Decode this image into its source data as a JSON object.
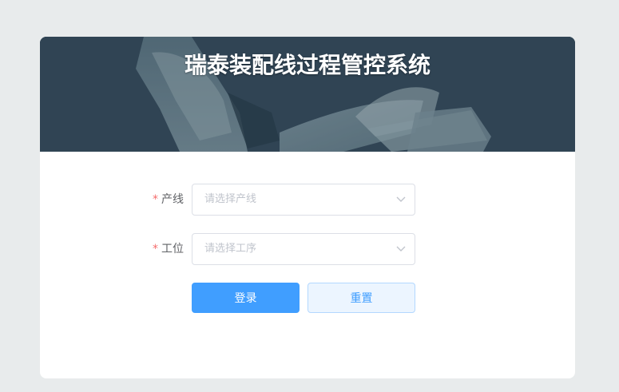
{
  "app": {
    "title": "瑞泰装配线过程管控系统"
  },
  "form": {
    "required_mark": "*",
    "line": {
      "label": "产线",
      "placeholder": "请选择产线"
    },
    "station": {
      "label": "工位",
      "placeholder": "请选择工序"
    },
    "login_label": "登录",
    "reset_label": "重置"
  },
  "icons": {
    "select_arrow": "chevron-down-icon"
  },
  "colors": {
    "primary": "#409eff",
    "required": "#f56c6c",
    "banner": "#34495a"
  }
}
